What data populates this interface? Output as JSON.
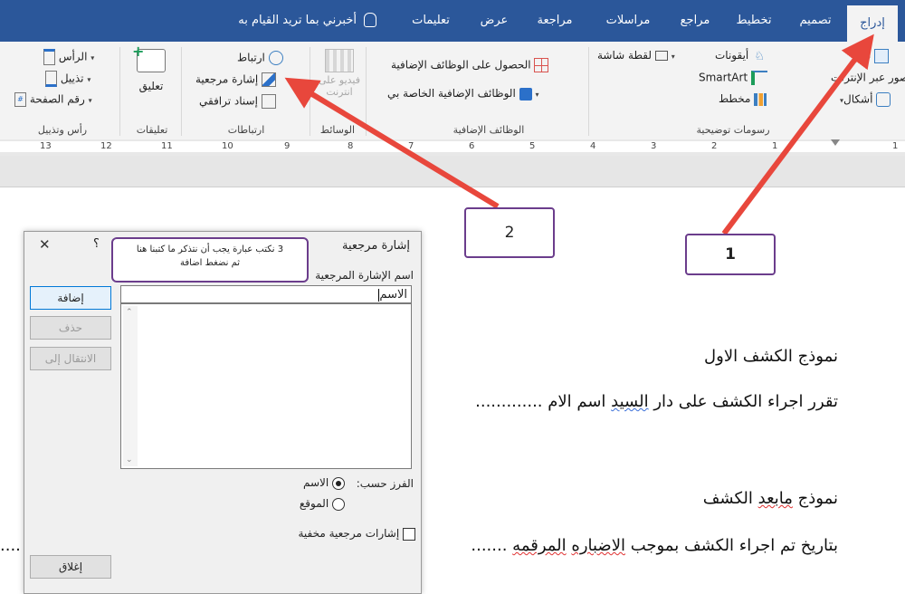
{
  "tabs": [
    "إدراج",
    "تصميم",
    "تخطيط",
    "مراجع",
    "مراسلات",
    "مراجعة",
    "عرض",
    "تعليمات"
  ],
  "tell_me": "أخبرني بما تريد القيام به",
  "ribbon": {
    "illustrations": {
      "label": "رسومات توضيحية",
      "pictures": "صور",
      "online_pictures": "صور عبر الإنترنت",
      "shapes": "أشكال",
      "icons": "أيقونات",
      "smartart": "SmartArt",
      "chart": "مخطط",
      "screenshot": "لقطة شاشة"
    },
    "addins": {
      "label": "الوظائف الإضافية",
      "get_addins": "الحصول على الوظائف الإضافية",
      "my_addins": "الوظائف الإضافية الخاصة بي"
    },
    "media": {
      "label": "الوسائط",
      "online_video_l1": "فيديو على",
      "online_video_l2": "انترنت"
    },
    "links": {
      "label": "ارتباطات",
      "link": "ارتباط",
      "bookmark": "إشارة مرجعية",
      "cross_ref": "إسناد ترافقي"
    },
    "comments": {
      "label": "تعليقات",
      "comment": "تعليق"
    },
    "header_footer": {
      "label": "رأس وتذييل",
      "header": "الرأس",
      "footer": "تذييل",
      "page_number": "رقم الصفحة"
    }
  },
  "ruler_numbers": [
    "1",
    "1",
    "2",
    "3",
    "4",
    "5",
    "6",
    "7",
    "8",
    "9",
    "10",
    "11",
    "12",
    "13"
  ],
  "document": {
    "line1": "نموذج الكشف الاول",
    "line2_a": "تقرر اجراء الكشف على دار ",
    "line2_b": "السيد",
    "line2_c": "  اسم الام .............",
    "line3_a": "نموذج ",
    "line3_b": "مابعد",
    "line3_c": " الكشف",
    "line4_a": "بتاريخ تم اجراء الكشف بموجب ",
    "line4_b": "الاضباره",
    "line4_c": " ",
    "line4_d": "المرقمه",
    "line4_e": " .......",
    "line4_left_dots": "...."
  },
  "dialog": {
    "title": "إشارة مرجعية",
    "help": "؟",
    "close": "✕",
    "field_label": "اسم الإشارة المرجعية",
    "field_value": "الاسم",
    "add": "إضافة",
    "delete": "حذف",
    "goto": "الانتقال إلى",
    "sort_by": "الفرز حسب:",
    "sort_name": "الاسم",
    "sort_location": "الموقع",
    "hidden": "إشارات مرجعية مخفية",
    "close_btn": "إغلاق"
  },
  "callouts": {
    "c1": "1",
    "c2": "2",
    "c3_l1": "3 نكتب عبارة يجب أن نتذكر ما كتبنا هنا",
    "c3_l2": "ثم نضغط اضافة"
  },
  "colors": {
    "ribbon_blue": "#2b579a",
    "arrow_red": "#e8473c",
    "callout_border": "#6b3d8c"
  }
}
